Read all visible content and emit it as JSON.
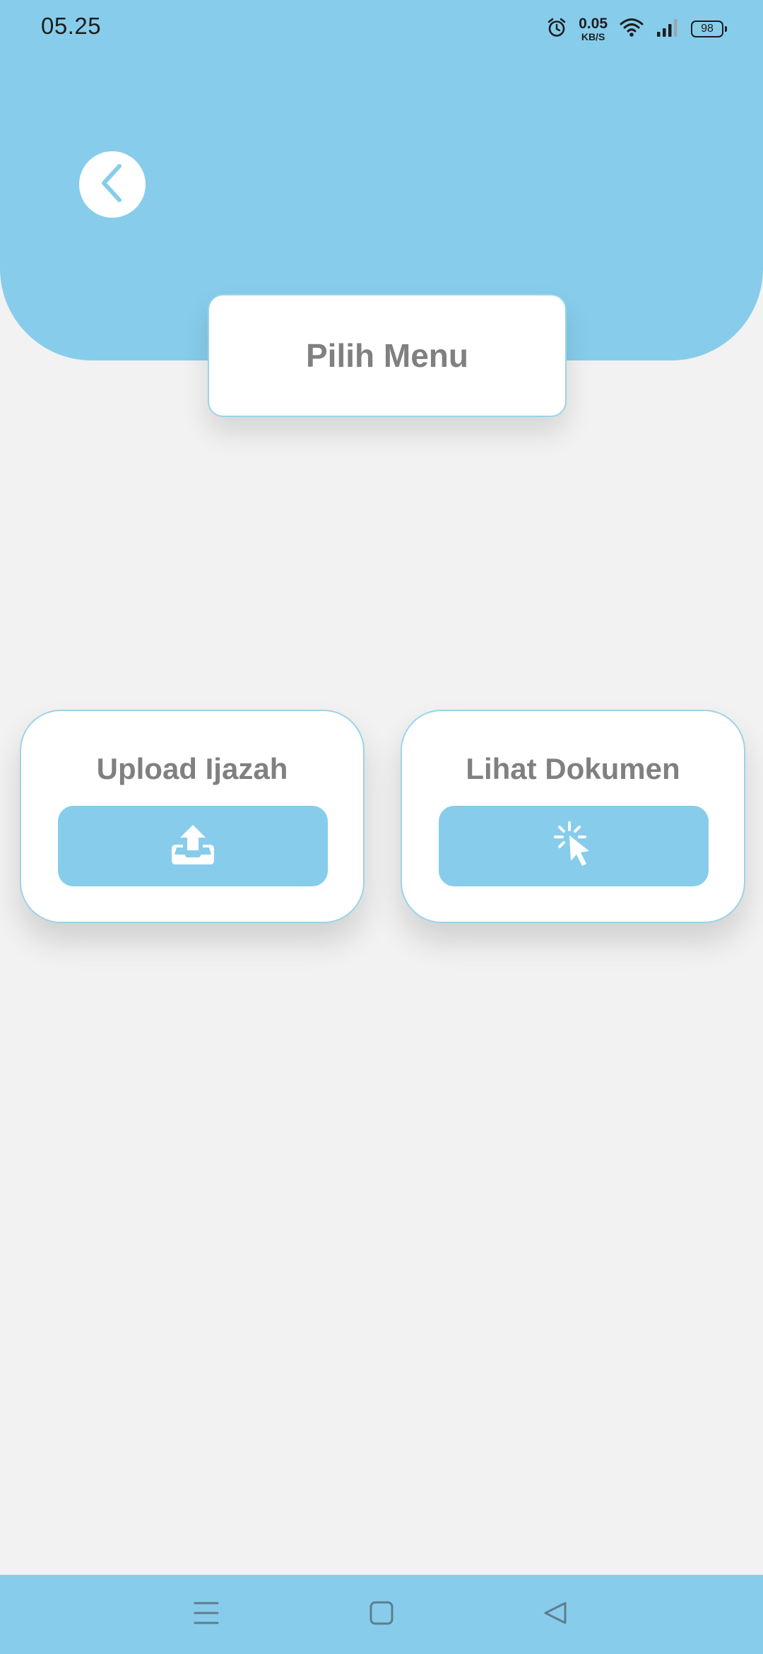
{
  "status_bar": {
    "time": "05.25",
    "net_speed_value": "0.05",
    "net_speed_unit": "KB/S",
    "battery_level": "98",
    "icons": [
      "alarm-icon",
      "wifi-icon",
      "signal-icon",
      "battery-icon"
    ]
  },
  "header": {
    "back_icon": "chevron-left-icon",
    "title": "Pilih Menu"
  },
  "menu": {
    "items": [
      {
        "label": "Upload Ijazah",
        "icon": "upload-tray-icon"
      },
      {
        "label": "Lihat Dokumen",
        "icon": "cursor-click-icon"
      }
    ]
  },
  "nav_bar": {
    "icons": [
      "menu-lines-icon",
      "home-square-icon",
      "back-triangle-icon"
    ]
  },
  "colors": {
    "accent": "#87cdeb",
    "background": "#f2f2f2",
    "card": "#ffffff",
    "text_gray": "#808080"
  }
}
